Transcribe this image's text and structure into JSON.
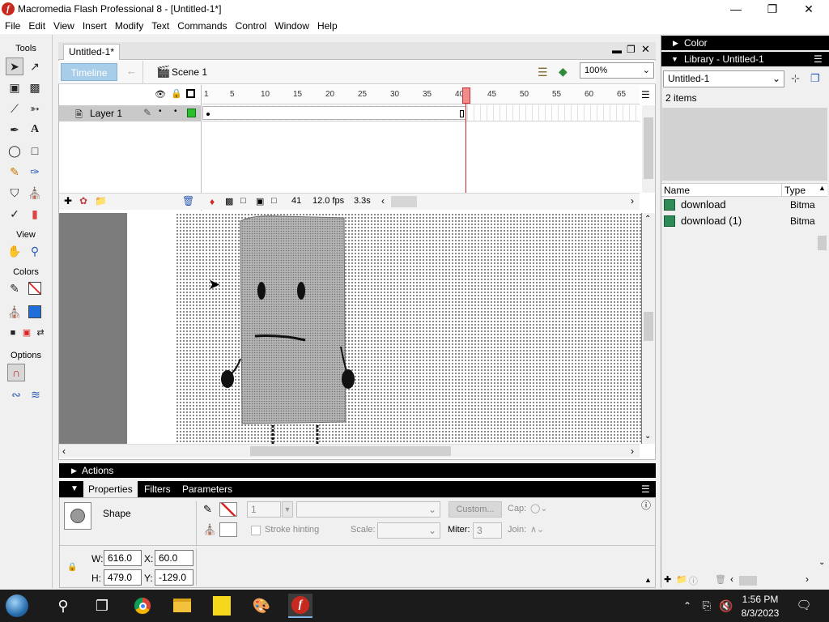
{
  "window": {
    "title": "Macromedia Flash Professional 8 - [Untitled-1*]",
    "app_icon": "flash-icon"
  },
  "menu": [
    "File",
    "Edit",
    "View",
    "Insert",
    "Modify",
    "Text",
    "Commands",
    "Control",
    "Window",
    "Help"
  ],
  "tools": {
    "heading": "Tools",
    "view_heading": "View",
    "colors_heading": "Colors",
    "options_heading": "Options"
  },
  "document": {
    "tab": "Untitled-1*",
    "timeline_button": "Timeline",
    "scene": "Scene 1",
    "zoom": "100%"
  },
  "timeline": {
    "ruler": [
      "1",
      "5",
      "10",
      "15",
      "20",
      "25",
      "30",
      "35",
      "40",
      "45",
      "50",
      "55",
      "60",
      "65"
    ],
    "layer_name": "Layer 1",
    "current_frame": "41",
    "fps": "12.0 fps",
    "elapsed": "3.3s"
  },
  "actions_panel": {
    "title": "Actions"
  },
  "properties": {
    "tabs": [
      "Properties",
      "Filters",
      "Parameters"
    ],
    "selection_type": "Shape",
    "stroke_height": "1",
    "custom_button": "Custom...",
    "cap_label": "Cap:",
    "stroke_hinting": "Stroke hinting",
    "scale_label": "Scale:",
    "miter_label": "Miter:",
    "miter_value": "3",
    "join_label": "Join:",
    "w_label": "W:",
    "w_value": "616.0",
    "x_label": "X:",
    "x_value": "60.0",
    "h_label": "H:",
    "h_value": "479.0",
    "y_label": "Y:",
    "y_value": "-129.0"
  },
  "right_panel": {
    "color_title": "Color",
    "library_title": "Library - Untitled-1",
    "library_select": "Untitled-1",
    "item_count": "2 items",
    "columns": {
      "name": "Name",
      "type": "Type"
    },
    "items": [
      {
        "name": "download",
        "type": "Bitmap"
      },
      {
        "name": "download (1)",
        "type": "Bitmap"
      }
    ]
  },
  "taskbar": {
    "time": "1:56 PM",
    "date": "8/3/2023",
    "apps": [
      "start-icon",
      "search-icon",
      "task-view-icon",
      "chrome-icon",
      "file-explorer-icon",
      "sticky-notes-icon",
      "paint-icon",
      "flash-icon"
    ]
  },
  "colors": {
    "accent": "#a7cde9",
    "playhead": "#d32626",
    "flash": "#c8291e"
  }
}
